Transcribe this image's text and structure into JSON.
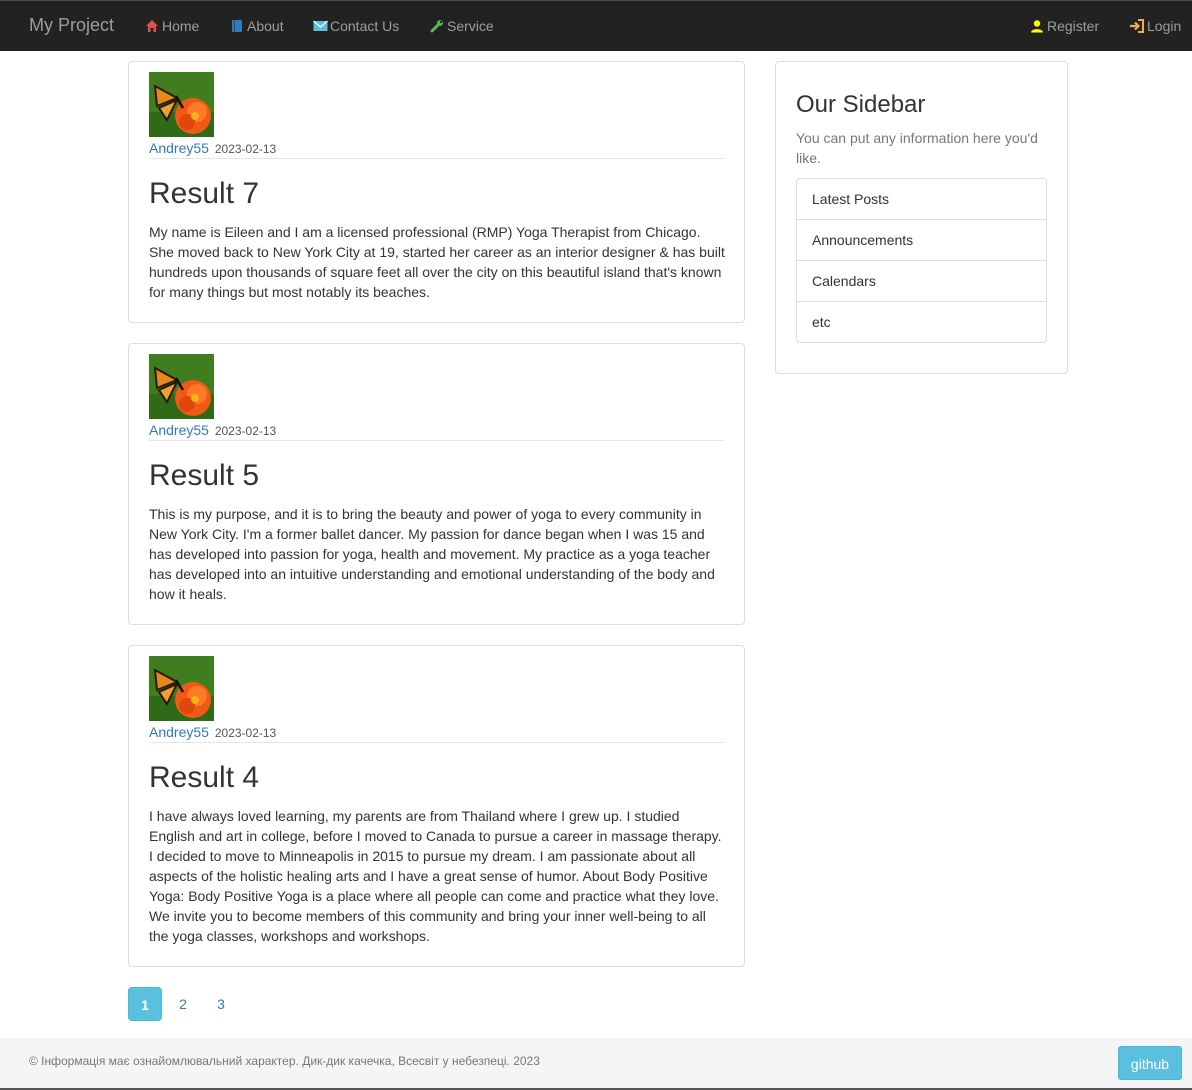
{
  "nav": {
    "brand": "My Project",
    "items": [
      {
        "label": "Home",
        "icon": "home-icon",
        "color": "#d9534f"
      },
      {
        "label": "About",
        "icon": "book-icon",
        "color": "#337ab7"
      },
      {
        "label": "Contact Us",
        "icon": "envelope-icon",
        "color": "#5bc0de"
      },
      {
        "label": "Service",
        "icon": "wrench-icon",
        "color": "#5cb85c"
      }
    ],
    "right": [
      {
        "label": "Register",
        "icon": "user-icon",
        "color": "#ffff00"
      },
      {
        "label": "Login",
        "icon": "log-in-icon",
        "color": "#f0ad4e"
      }
    ]
  },
  "posts": [
    {
      "author": "Andrey55",
      "date": "2023-02-13",
      "title": "Result 7",
      "body": "My name is Eileen and I am a licensed professional (RMP) Yoga Therapist from Chicago. She moved back to New York City at 19, started her career as an interior designer & has built hundreds upon thousands of square feet all over the city on this beautiful island that's known for many things but most notably its beaches."
    },
    {
      "author": "Andrey55",
      "date": "2023-02-13",
      "title": "Result 5",
      "body": "This is my purpose, and it is to bring the beauty and power of yoga to every community in New York City. I'm a former ballet dancer. My passion for dance began when I was 15 and has developed into passion for yoga, health and movement. My practice as a yoga teacher has developed into an intuitive understanding and emotional understanding of the body and how it heals."
    },
    {
      "author": "Andrey55",
      "date": "2023-02-13",
      "title": "Result 4",
      "body": "I have always loved learning, my parents are from Thailand where I grew up. I studied English and art in college, before I moved to Canada to pursue a career in massage therapy. I decided to move to Minneapolis in 2015 to pursue my dream. I am passionate about all aspects of the holistic healing arts and I have a great sense of humor. About Body Positive Yoga: Body Positive Yoga is a place where all people can come and practice what they love. We invite you to become members of this community and bring your inner well-being to all the yoga classes, workshops and workshops."
    }
  ],
  "sidebar": {
    "title": "Our Sidebar",
    "text": "You can put any information here you'd like.",
    "links": [
      "Latest Posts",
      "Announcements",
      "Calendars",
      "etc"
    ]
  },
  "pagination": {
    "pages": [
      "1",
      "2",
      "3"
    ],
    "active": "1"
  },
  "footer": {
    "copyright": "© Інформація має ознайомлювальний характер. Дик-дик качечка, Всесвіт у небезпеці. 2023",
    "github_label": "github"
  },
  "colors": {
    "navbar_bg": "#222222",
    "link": "#337ab7",
    "accent_info": "#5bc0de"
  }
}
